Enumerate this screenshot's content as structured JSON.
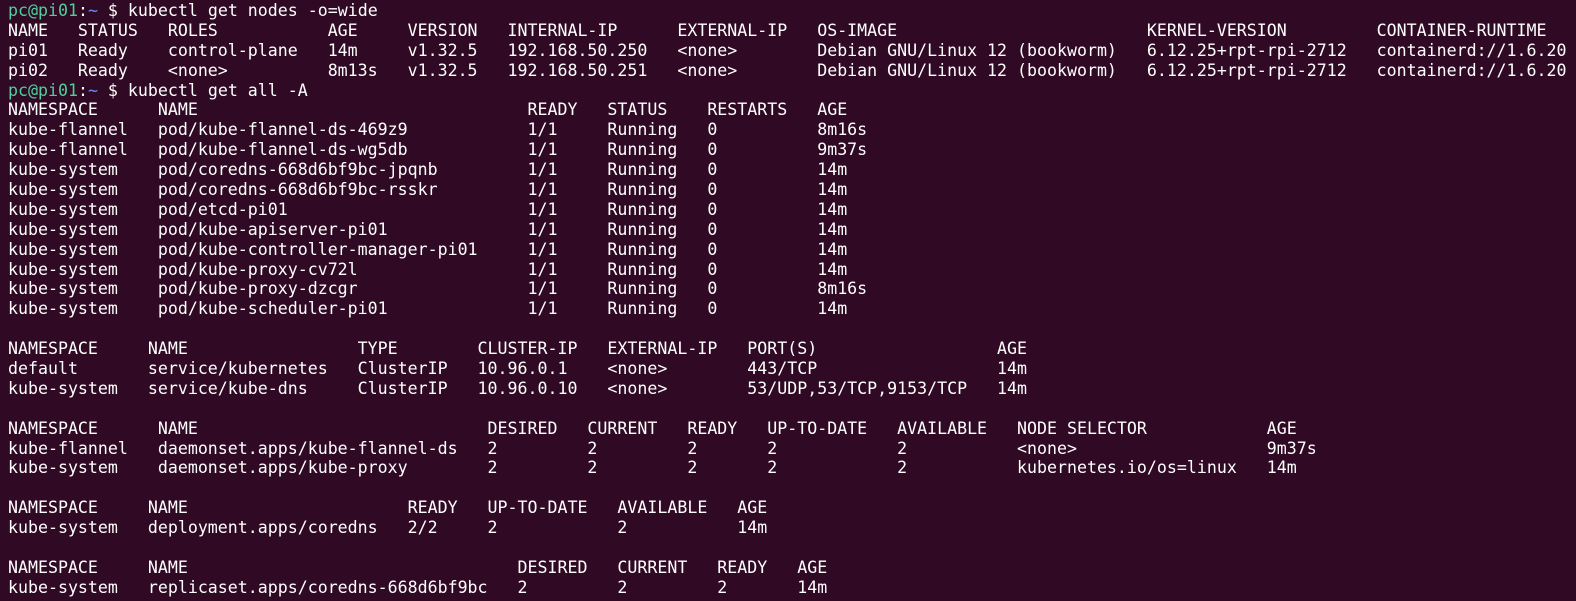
{
  "colors": {
    "background": "#300a24",
    "foreground": "#ffffff",
    "prompt_user": "#4fcf9b",
    "prompt_path": "#6b8cff"
  },
  "prompt": {
    "user_host": "pc@pi01",
    "colon": ":",
    "path": "~",
    "symbol": " $ "
  },
  "commands": [
    "kubectl get nodes -o=wide",
    "kubectl get all -A"
  ],
  "lines": [
    "NAME   STATUS   ROLES           AGE     VERSION   INTERNAL-IP      EXTERNAL-IP   OS-IMAGE                         KERNEL-VERSION         CONTAINER-RUNTIME",
    "pi01   Ready    control-plane   14m     v1.32.5   192.168.50.250   <none>        Debian GNU/Linux 12 (bookworm)   6.12.25+rpt-rpi-2712   containerd://1.6.20",
    "pi02   Ready    <none>          8m13s   v1.32.5   192.168.50.251   <none>        Debian GNU/Linux 12 (bookworm)   6.12.25+rpt-rpi-2712   containerd://1.6.20",
    "NAMESPACE      NAME                                 READY   STATUS    RESTARTS   AGE",
    "kube-flannel   pod/kube-flannel-ds-469z9            1/1     Running   0          8m16s",
    "kube-flannel   pod/kube-flannel-ds-wg5db            1/1     Running   0          9m37s",
    "kube-system    pod/coredns-668d6bf9bc-jpqnb         1/1     Running   0          14m",
    "kube-system    pod/coredns-668d6bf9bc-rsskr         1/1     Running   0          14m",
    "kube-system    pod/etcd-pi01                        1/1     Running   0          14m",
    "kube-system    pod/kube-apiserver-pi01              1/1     Running   0          14m",
    "kube-system    pod/kube-controller-manager-pi01     1/1     Running   0          14m",
    "kube-system    pod/kube-proxy-cv72l                 1/1     Running   0          14m",
    "kube-system    pod/kube-proxy-dzcgr                 1/1     Running   0          8m16s",
    "kube-system    pod/kube-scheduler-pi01              1/1     Running   0          14m",
    "",
    "NAMESPACE     NAME                 TYPE        CLUSTER-IP   EXTERNAL-IP   PORT(S)                  AGE",
    "default       service/kubernetes   ClusterIP   10.96.0.1    <none>        443/TCP                  14m",
    "kube-system   service/kube-dns     ClusterIP   10.96.0.10   <none>        53/UDP,53/TCP,9153/TCP   14m",
    "",
    "NAMESPACE      NAME                             DESIRED   CURRENT   READY   UP-TO-DATE   AVAILABLE   NODE SELECTOR            AGE",
    "kube-flannel   daemonset.apps/kube-flannel-ds   2         2         2       2            2           <none>                   9m37s",
    "kube-system    daemonset.apps/kube-proxy        2         2         2       2            2           kubernetes.io/os=linux   14m",
    "",
    "NAMESPACE     NAME                      READY   UP-TO-DATE   AVAILABLE   AGE",
    "kube-system   deployment.apps/coredns   2/2     2            2           14m",
    "",
    "NAMESPACE     NAME                                 DESIRED   CURRENT   READY   AGE",
    "kube-system   replicaset.apps/coredns-668d6bf9bc   2         2         2       14m"
  ]
}
